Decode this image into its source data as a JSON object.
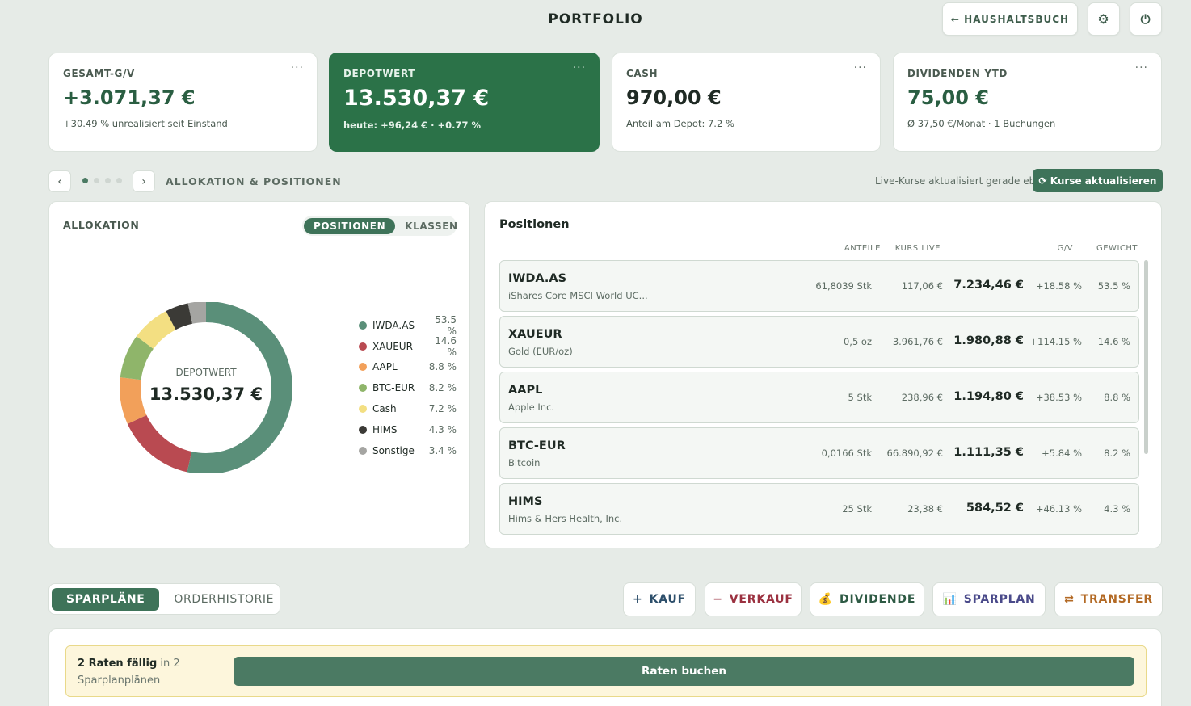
{
  "header": {
    "title": "PORTFOLIO",
    "back_label": "← HAUSHALTSBUCH",
    "settings_icon": "⚙",
    "power_icon": "⏻"
  },
  "kpis": [
    {
      "label": "GESAMT-G/V",
      "value": "+3.071,37 €",
      "sub": "+30.49 % unrealisiert seit Einstand"
    },
    {
      "label": "DEPOTWERT",
      "value": "13.530,37 €",
      "sub": "heute: +96,24 € · +0.77 %"
    },
    {
      "label": "CASH",
      "value": "970,00 €",
      "sub": "Anteil am Depot: 7.2 %"
    },
    {
      "label": "DIVIDENDEN YTD",
      "value": "75,00 €",
      "sub": "Ø 37,50 €/Monat · 1 Buchungen"
    }
  ],
  "kpi_menu": "···",
  "section": {
    "prev": "‹",
    "next": "›",
    "title": "ALLOKATION & POSITIONEN",
    "live_text": "Live-Kurse aktualisiert gerade eben",
    "refresh_label": "⟳ Kurse aktualisieren"
  },
  "allocation": {
    "title": "ALLOKATION",
    "tabs": [
      "POSITIONEN",
      "KLASSEN"
    ],
    "center_label": "DEPOTWERT",
    "center_value": "13.530,37 €",
    "slices": [
      {
        "name": "IWDA.AS",
        "pct_label": "53.5 %",
        "pct": 53.5,
        "color": "#5a8f79"
      },
      {
        "name": "XAUEUR",
        "pct_label": "14.6 %",
        "pct": 14.6,
        "color": "#b94a51"
      },
      {
        "name": "AAPL",
        "pct_label": "8.8 %",
        "pct": 8.8,
        "color": "#f2a05a"
      },
      {
        "name": "BTC-EUR",
        "pct_label": "8.2 %",
        "pct": 8.2,
        "color": "#8fb56a"
      },
      {
        "name": "Cash",
        "pct_label": "7.2 %",
        "pct": 7.2,
        "color": "#f3df82"
      },
      {
        "name": "HIMS",
        "pct_label": "4.3 %",
        "pct": 4.3,
        "color": "#3b3a36"
      },
      {
        "name": "Sonstige",
        "pct_label": "3.4 %",
        "pct": 3.4,
        "color": "#a5a5a2"
      }
    ]
  },
  "positions": {
    "title": "Positionen",
    "columns": [
      "ANTEILE",
      "KURS LIVE",
      "G/V",
      "GEWICHT"
    ],
    "rows": [
      {
        "ticker": "IWDA.AS",
        "name": "iShares Core MSCI World UC...",
        "shares": "61,8039 Stk",
        "price": "117,06 €",
        "value": "7.234,46 €",
        "gv": "+18.58 %",
        "weight": "53.5 %"
      },
      {
        "ticker": "XAUEUR",
        "name": "Gold (EUR/oz)",
        "shares": "0,5 oz",
        "price": "3.961,76 €",
        "value": "1.980,88 €",
        "gv": "+114.15 %",
        "weight": "14.6 %"
      },
      {
        "ticker": "AAPL",
        "name": "Apple Inc.",
        "shares": "5 Stk",
        "price": "238,96 €",
        "value": "1.194,80 €",
        "gv": "+38.53 %",
        "weight": "8.8 %"
      },
      {
        "ticker": "BTC-EUR",
        "name": "Bitcoin",
        "shares": "0,0166 Stk",
        "price": "66.890,92 €",
        "value": "1.111,35 €",
        "gv": "+5.84 %",
        "weight": "8.2 %"
      },
      {
        "ticker": "HIMS",
        "name": "Hims & Hers Health, Inc.",
        "shares": "25 Stk",
        "price": "23,38 €",
        "value": "584,52 €",
        "gv": "+46.13 %",
        "weight": "4.3 %"
      }
    ]
  },
  "bottom": {
    "tabs": [
      "SPARPLÄNE",
      "ORDERHISTORIE"
    ],
    "actions": [
      {
        "icon": "+",
        "label": "KAUF",
        "color": "#2d4f6b"
      },
      {
        "icon": "−",
        "label": "VERKAUF",
        "color": "#9b3140"
      },
      {
        "icon": "💰",
        "label": "DIVIDENDE",
        "color": "#2e5a44"
      },
      {
        "icon": "📊",
        "label": "SPARPLAN",
        "color": "#4a4a8a"
      },
      {
        "icon": "⇄",
        "label": "TRANSFER",
        "color": "#b36a25"
      }
    ],
    "due_strong": "2 Raten fällig",
    "due_rest": " in 2",
    "due_line2": "Sparplanplänen",
    "book_label": "Raten buchen"
  }
}
